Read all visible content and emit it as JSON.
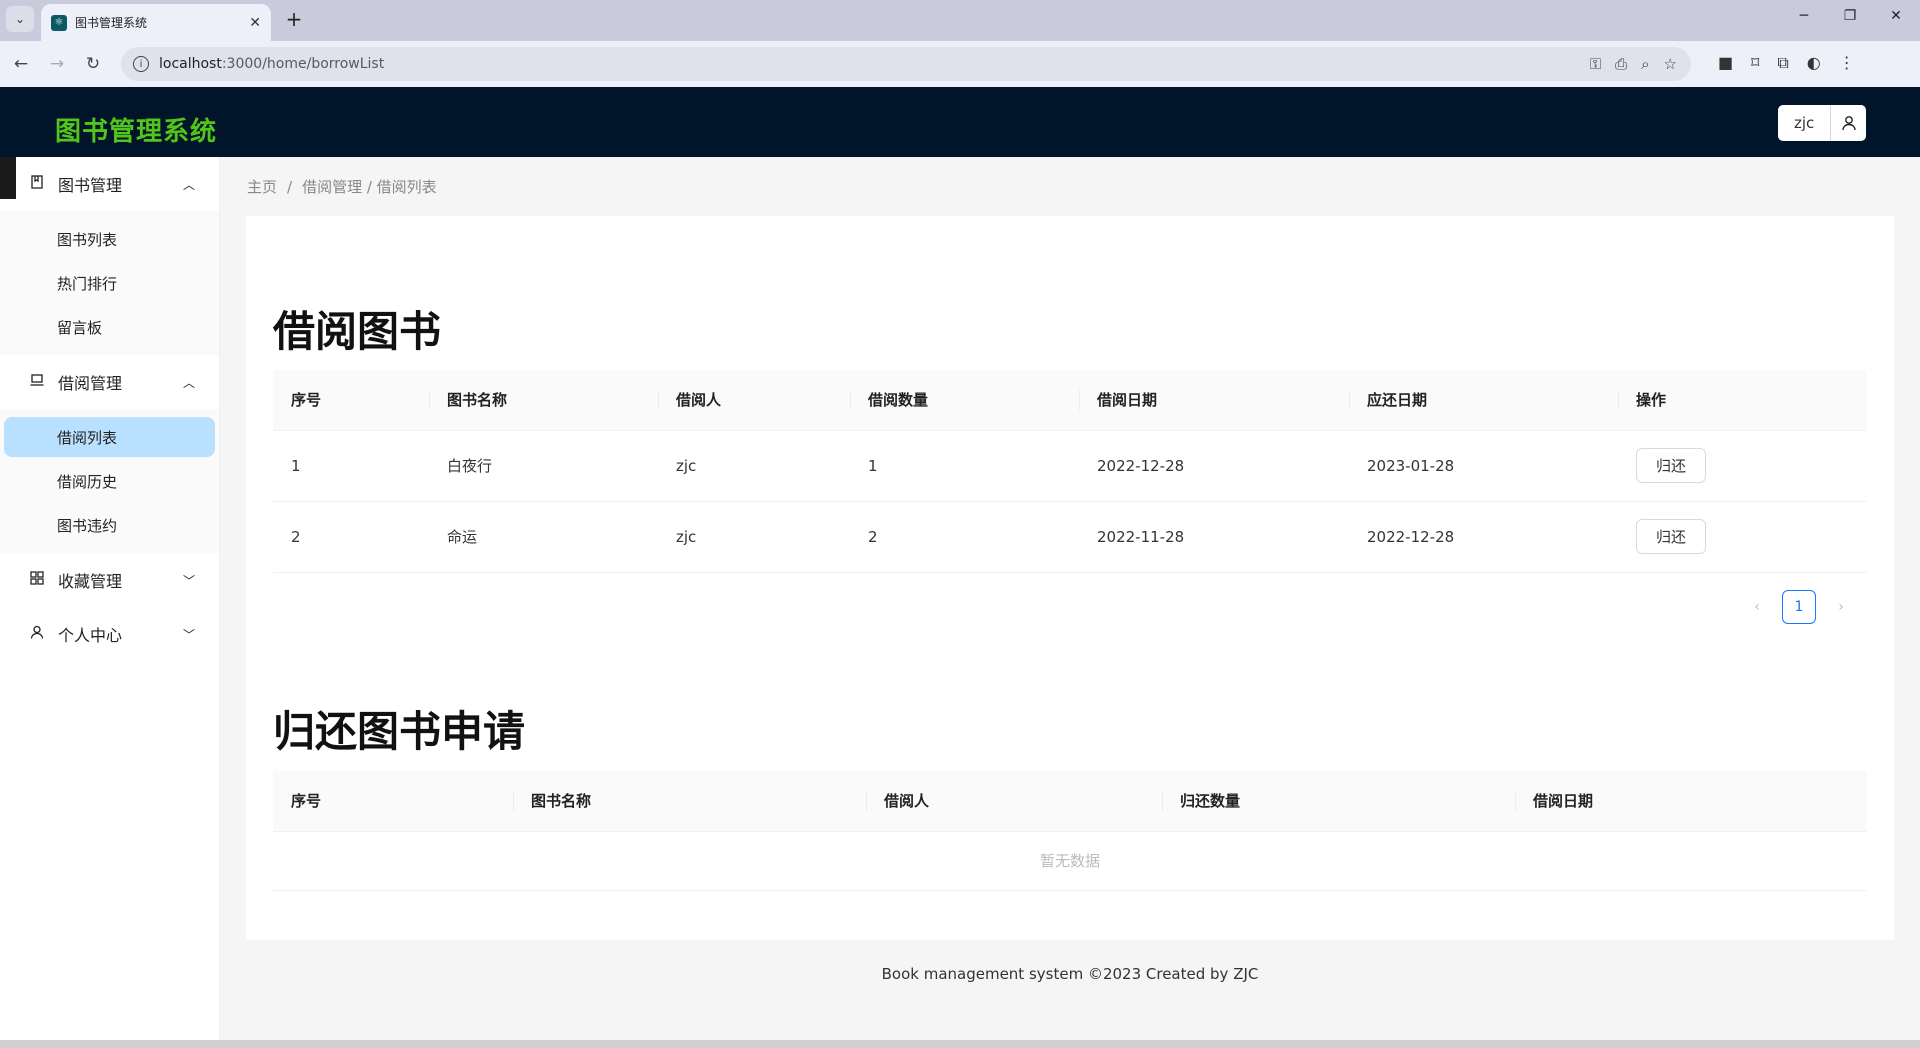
{
  "browser": {
    "tab_title": "图书管理系统",
    "url_host": "localhost",
    "url_path": ":3000/home/borrowList"
  },
  "header": {
    "logo": "图书管理系统",
    "username": "zjc"
  },
  "sidebar": {
    "groups": [
      {
        "label": "图书管理",
        "icon": "book-icon",
        "expanded": true,
        "items": [
          "图书列表",
          "热门排行",
          "留言板"
        ]
      },
      {
        "label": "借阅管理",
        "icon": "laptop-icon",
        "expanded": true,
        "items": [
          "借阅列表",
          "借阅历史",
          "图书违约"
        ]
      },
      {
        "label": "收藏管理",
        "icon": "grid-icon",
        "expanded": false,
        "items": []
      },
      {
        "label": "个人中心",
        "icon": "user-icon",
        "expanded": false,
        "items": []
      }
    ],
    "active_item": "借阅列表"
  },
  "breadcrumb": {
    "home": "主页",
    "sep": "/",
    "current": "借阅管理 / 借阅列表"
  },
  "borrow": {
    "title": "借阅图书",
    "columns": [
      "序号",
      "图书名称",
      "借阅人",
      "借阅数量",
      "借阅日期",
      "应还日期",
      "操作"
    ],
    "rows": [
      {
        "no": "1",
        "name": "白夜行",
        "borrower": "zjc",
        "qty": "1",
        "borrow_date": "2022-12-28",
        "due_date": "2023-01-28",
        "action": "归还"
      },
      {
        "no": "2",
        "name": "命运",
        "borrower": "zjc",
        "qty": "2",
        "borrow_date": "2022-11-28",
        "due_date": "2022-12-28",
        "action": "归还"
      }
    ],
    "page": "1"
  },
  "returns": {
    "title": "归还图书申请",
    "columns": [
      "序号",
      "图书名称",
      "借阅人",
      "归还数量",
      "借阅日期"
    ],
    "empty_text": "暂无数据"
  },
  "footer": "Book management system ©2023 Created by ZJC",
  "colors": {
    "header_bg": "#001529",
    "logo": "#52c41a",
    "active_bg": "#bae0ff",
    "primary": "#1677ff"
  }
}
